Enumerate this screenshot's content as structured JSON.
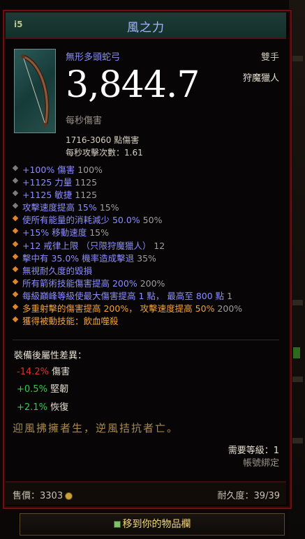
{
  "item": {
    "ilvl": "i5",
    "name": "風之力",
    "type": "無形多頭蛇弓",
    "slot": "雙手",
    "dps": "3,844.7",
    "class_req": "狩魔獵人",
    "dps_label": "每秒傷害",
    "damage": "1716-3060 點傷害",
    "attacks_per_second": "每秒攻擊次數：1.61"
  },
  "affixes": [
    {
      "color": "blue",
      "bullet": "gray",
      "text": "+100% 傷害",
      "extra": " 100%"
    },
    {
      "color": "blue",
      "bullet": "gray",
      "text": "+1125 力量",
      "extra": " 1125"
    },
    {
      "color": "blue",
      "bullet": "gray",
      "text": "+1125 敏捷",
      "extra": " 1125"
    },
    {
      "color": "blue",
      "bullet": "gray",
      "text": "攻擊速度提高 15%",
      "extra": " 15%"
    },
    {
      "color": "blue",
      "bullet": "orange",
      "text": "使所有能量的消耗減少 50.0%",
      "extra": " 50%"
    },
    {
      "color": "blue",
      "bullet": "orange",
      "text": "+15% 移動速度",
      "extra": " 15%"
    },
    {
      "color": "blue",
      "bullet": "orange",
      "text": "+12 戒律上限 （只限狩魔獵人）",
      "extra": "  12"
    },
    {
      "color": "blue",
      "bullet": "orange",
      "text": "擊中有 35.0% 機率造成擊退",
      "extra": " 35%"
    },
    {
      "color": "blue",
      "bullet": "orange",
      "text": "無視耐久度的毀損",
      "extra": ""
    },
    {
      "color": "blue",
      "bullet": "orange",
      "text": "所有箭術技能傷害提高 200%",
      "extra": " 200%"
    },
    {
      "color": "blue",
      "bullet": "orange",
      "text": "每級巔峰等級使最大傷害提高 1 點， 最高至 800 點",
      "extra": " 1"
    },
    {
      "color": "orange",
      "bullet": "orange",
      "text": "多重射擊的傷害提高 200%， 攻擊速度提高 50%",
      "extra": " 200%"
    },
    {
      "color": "orange",
      "bullet": "orange",
      "text": "獲得被動技能：飲血噬殺",
      "extra": ""
    }
  ],
  "compare": {
    "title": "裝備後屬性差異：",
    "rows": [
      {
        "value": "-14.2%",
        "label": "傷害",
        "sign": "neg"
      },
      {
        "value": "+0.5%",
        "label": "堅韌",
        "sign": "pos"
      },
      {
        "value": "+2.1%",
        "label": "恢復",
        "sign": "pos"
      }
    ]
  },
  "flavor": "迎風拂擁者生，逆風拮抗者亡。",
  "requirement": "需要等級：1",
  "account_bound": "帳號綁定",
  "footer": {
    "price_label": "售價：",
    "price_value": "3303",
    "durability": "耐久度：39/39"
  },
  "move_button": "移到你的物品欄",
  "colors": {
    "border": "#6e1010",
    "title": "#a7b5ff",
    "magic_blue": "#8d8dff",
    "legendary_orange": "#f2a23a",
    "negative": "#e0302a",
    "positive": "#29d146",
    "flavor": "#a98a4c",
    "button_text": "#f3d97a"
  }
}
